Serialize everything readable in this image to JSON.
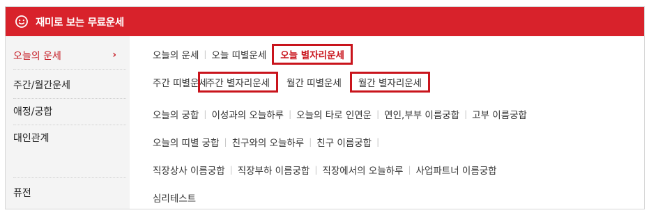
{
  "header": {
    "title": "재미로 보는 무료운세",
    "icon": "smile-icon"
  },
  "sidebar": {
    "items": [
      {
        "label": "오늘의 운세",
        "active": true,
        "chevron": "›"
      },
      {
        "label": "주간/월간운세"
      },
      {
        "label": "애정/궁합"
      },
      {
        "label": "대인관계"
      },
      {
        "label": "퓨전"
      }
    ]
  },
  "content": {
    "row1": [
      "오늘의 운세",
      "오늘 띠별운세",
      "오늘 별자리운세"
    ],
    "row2": [
      "주간 띠별운세",
      "주간 별자리운세",
      "월간 띠별운세",
      "월간 별자리운세"
    ],
    "row3": [
      "오늘의 궁합",
      "이성과의 오늘하루",
      "오늘의 타로 인연운",
      "연인,부부 이름궁합",
      "고부 이름궁합"
    ],
    "row4": [
      "오늘의 띠별 궁합",
      "친구와의 오늘하루",
      "친구 이름궁합"
    ],
    "row5": [
      "직장상사 이름궁합",
      "직장부하 이름궁합",
      "직장에서의 오늘하루",
      "사업파트너 이름궁합"
    ],
    "row6": [
      "심리테스트"
    ],
    "highlight_color": "#c9141c",
    "header_color": "#d8222b"
  }
}
